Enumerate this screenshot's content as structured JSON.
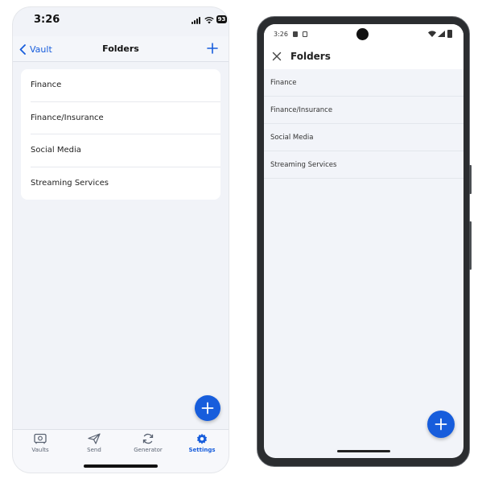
{
  "ios": {
    "status": {
      "time": "3:26",
      "battery": "93"
    },
    "nav": {
      "back_label": "Vault",
      "title": "Folders"
    },
    "folders": [
      {
        "label": "Finance"
      },
      {
        "label": "Finance/Insurance"
      },
      {
        "label": "Social Media"
      },
      {
        "label": "Streaming Services"
      }
    ],
    "tabs": [
      {
        "label": "Vaults",
        "icon": "vault-icon"
      },
      {
        "label": "Send",
        "icon": "send-icon"
      },
      {
        "label": "Generator",
        "icon": "generator-icon"
      },
      {
        "label": "Settings",
        "icon": "settings-icon",
        "active": true
      }
    ]
  },
  "android": {
    "status": {
      "time": "3:26"
    },
    "title": "Folders",
    "folders": [
      {
        "label": "Finance"
      },
      {
        "label": "Finance/Insurance"
      },
      {
        "label": "Social Media"
      },
      {
        "label": "Streaming Services"
      }
    ]
  },
  "colors": {
    "accent": "#175ddc",
    "background": "#f1f3f8",
    "surface": "#ffffff"
  }
}
